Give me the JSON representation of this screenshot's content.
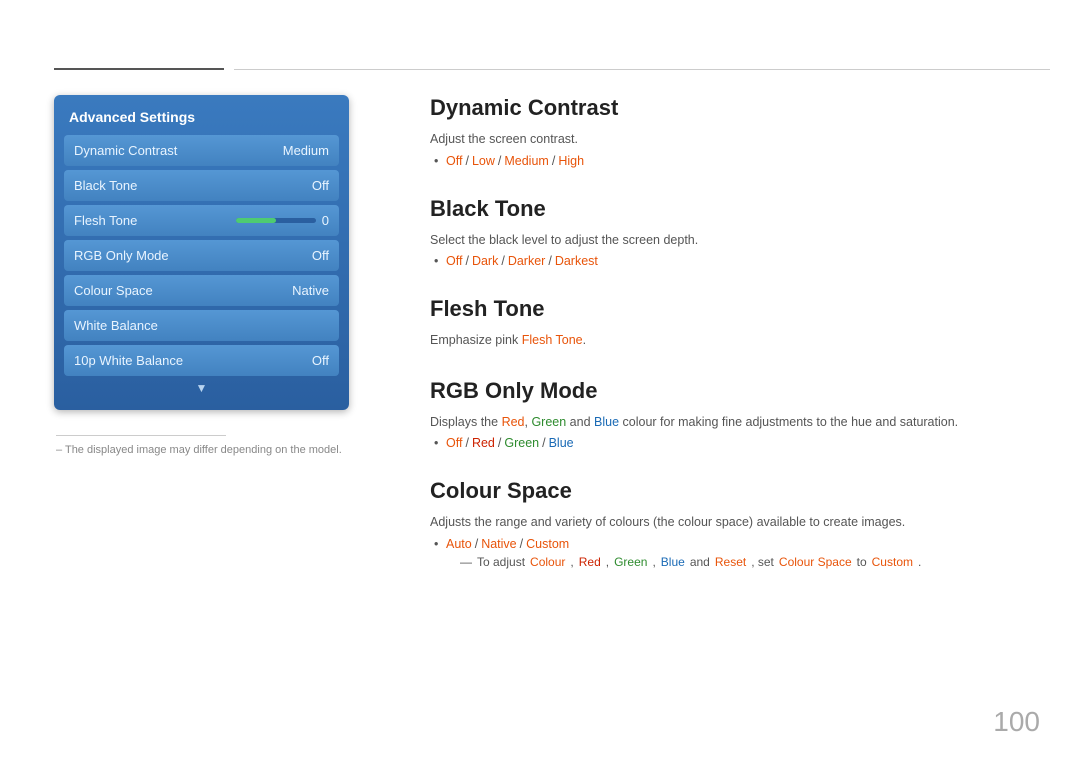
{
  "topLines": {},
  "leftPanel": {
    "title": "Advanced Settings",
    "menuItems": [
      {
        "label": "Dynamic Contrast",
        "value": "Medium"
      },
      {
        "label": "Black Tone",
        "value": "Off"
      },
      {
        "label": "RGB Only Mode",
        "value": "Off"
      },
      {
        "label": "Colour Space",
        "value": "Native"
      },
      {
        "label": "White Balance",
        "value": ""
      },
      {
        "label": "10p White Balance",
        "value": "Off"
      }
    ],
    "fleshTone": {
      "label": "Flesh Tone",
      "value": "0"
    }
  },
  "panelNote": "– The displayed image may differ depending on the model.",
  "sections": [
    {
      "id": "dynamic-contrast",
      "title": "Dynamic Contrast",
      "desc": "Adjust the screen contrast.",
      "options": [
        {
          "text": "Off",
          "highlight": true
        },
        {
          "text": "/",
          "highlight": false
        },
        {
          "text": "Low",
          "highlight": true
        },
        {
          "text": "/",
          "highlight": false
        },
        {
          "text": "Medium",
          "highlight": true
        },
        {
          "text": "/",
          "highlight": false
        },
        {
          "text": "High",
          "highlight": true
        }
      ],
      "subNote": null
    },
    {
      "id": "black-tone",
      "title": "Black Tone",
      "desc": "Select the black level to adjust the screen depth.",
      "options": [
        {
          "text": "Off",
          "highlight": true
        },
        {
          "text": "/",
          "highlight": false
        },
        {
          "text": "Dark",
          "highlight": true
        },
        {
          "text": "/",
          "highlight": false
        },
        {
          "text": "Darker",
          "highlight": true
        },
        {
          "text": "/",
          "highlight": false
        },
        {
          "text": "Darkest",
          "highlight": true
        }
      ],
      "subNote": null
    },
    {
      "id": "flesh-tone",
      "title": "Flesh Tone",
      "desc": "Emphasize pink Flesh Tone.",
      "options": null,
      "subNote": null
    },
    {
      "id": "rgb-only-mode",
      "title": "RGB Only Mode",
      "desc": "Displays the Red, Green and Blue colour for making fine adjustments to the hue and saturation.",
      "options": [
        {
          "text": "Off",
          "highlight": true
        },
        {
          "text": "/",
          "highlight": false
        },
        {
          "text": "Red",
          "highlight": true,
          "color": "red"
        },
        {
          "text": "/",
          "highlight": false
        },
        {
          "text": "Green",
          "highlight": true,
          "color": "green"
        },
        {
          "text": "/",
          "highlight": false
        },
        {
          "text": "Blue",
          "highlight": true,
          "color": "blue"
        }
      ],
      "subNote": null
    },
    {
      "id": "colour-space",
      "title": "Colour Space",
      "desc": "Adjusts the range and variety of colours (the colour space) available to create images.",
      "options": [
        {
          "text": "Auto",
          "highlight": true
        },
        {
          "text": "/",
          "highlight": false
        },
        {
          "text": "Native",
          "highlight": true
        },
        {
          "text": "/",
          "highlight": false
        },
        {
          "text": "Custom",
          "highlight": true
        }
      ],
      "subNote": "To adjust Colour, Red, Green, Blue and Reset, set Colour Space to Custom."
    }
  ],
  "pageNumber": "100"
}
